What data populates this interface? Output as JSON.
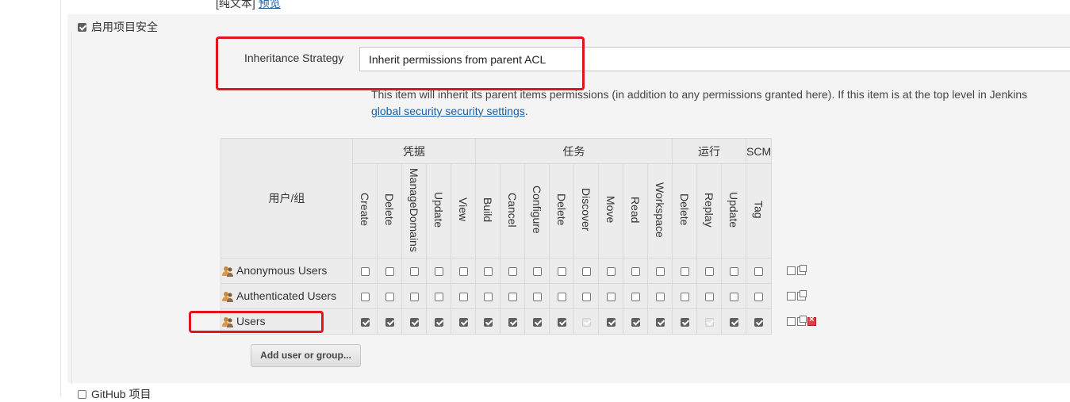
{
  "top_snippet": {
    "text": "[纯文本]",
    "link": "预览"
  },
  "enable_section": {
    "label": "启用项目安全",
    "checked": true
  },
  "inheritance": {
    "label": "Inheritance Strategy",
    "value": "Inherit permissions from parent ACL",
    "help_text": "This item will inherit its parent items permissions (in addition to any permissions granted here). If this item is at the top level in Jenkins",
    "help_link": "global security security settings",
    "help_end": "."
  },
  "matrix": {
    "user_header": "用户/组",
    "groups": [
      {
        "label": "凭据",
        "permissions": [
          "Create",
          "Delete",
          "ManageDomains",
          "Update",
          "View"
        ]
      },
      {
        "label": "任务",
        "permissions": [
          "Build",
          "Cancel",
          "Configure",
          "Delete",
          "Discover",
          "Move",
          "Read",
          "Workspace"
        ]
      },
      {
        "label": "运行",
        "permissions": [
          "Delete",
          "Replay",
          "Update"
        ]
      },
      {
        "label": "SCM",
        "permissions": [
          "Tag"
        ]
      }
    ],
    "rows": [
      {
        "name": "Anonymous Users",
        "values": [
          "off",
          "off",
          "off",
          "off",
          "off",
          "off",
          "off",
          "off",
          "off",
          "off",
          "off",
          "off",
          "off",
          "off",
          "off",
          "off",
          "off"
        ]
      },
      {
        "name": "Authenticated Users",
        "values": [
          "off",
          "off",
          "off",
          "off",
          "off",
          "off",
          "off",
          "off",
          "off",
          "off",
          "off",
          "off",
          "off",
          "off",
          "off",
          "off",
          "off"
        ]
      },
      {
        "name": "Users",
        "values": [
          "on",
          "on",
          "on",
          "on",
          "on",
          "on",
          "on",
          "on",
          "on",
          "disabled",
          "on",
          "on",
          "on",
          "on",
          "disabled",
          "on",
          "on"
        ]
      }
    ]
  },
  "add_button": "Add user or group...",
  "github_section": {
    "label": "GitHub 项目",
    "checked": false
  },
  "colors": {
    "highlight": "#e3141b",
    "link": "#1a5fa6",
    "panel": "#f4f4f4"
  }
}
